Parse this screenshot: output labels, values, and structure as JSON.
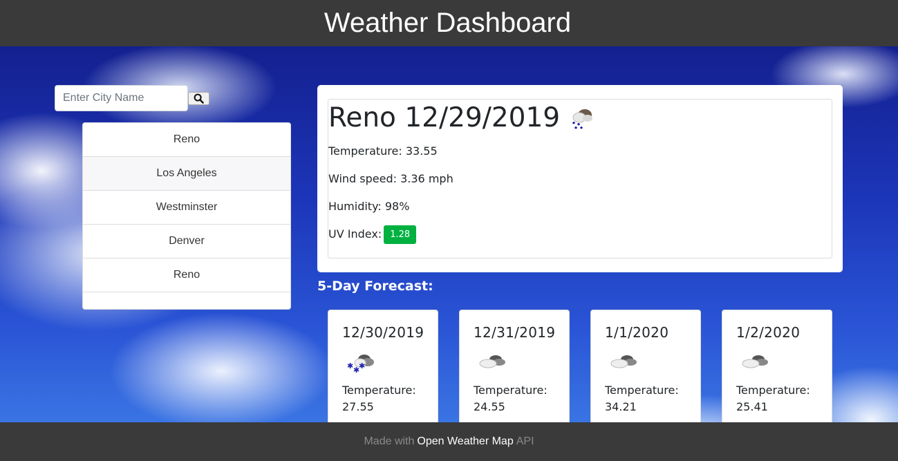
{
  "header": {
    "title": "Weather Dashboard"
  },
  "search": {
    "placeholder": "Enter City Name",
    "value": ""
  },
  "city_list": {
    "items": [
      {
        "label": "Reno"
      },
      {
        "label": "Los Angeles"
      },
      {
        "label": "Westminster"
      },
      {
        "label": "Denver"
      },
      {
        "label": "Reno"
      }
    ]
  },
  "current": {
    "title": "Reno 12/29/2019",
    "icon": "snow-rain-cloud-icon",
    "temperature": "Temperature: 33.55",
    "wind": "Wind speed: 3.36 mph",
    "humidity": "Humidity: 98%",
    "uv_label": "UV Index:",
    "uv_value": "1.28",
    "uv_color": "#00b140"
  },
  "forecast": {
    "heading": "5-Day Forecast:",
    "days": [
      {
        "date": "12/30/2019",
        "icon": "snow-cloud-icon",
        "temp_label": "Temperature:",
        "temp": "27.55"
      },
      {
        "date": "12/31/2019",
        "icon": "cloud-icon",
        "temp_label": "Temperature:",
        "temp": "24.55"
      },
      {
        "date": "1/1/2020",
        "icon": "cloud-icon",
        "temp_label": "Temperature:",
        "temp": "34.21"
      },
      {
        "date": "1/2/2020",
        "icon": "cloud-icon",
        "temp_label": "Temperature:",
        "temp": "25.41"
      }
    ]
  },
  "footer": {
    "prefix": "Made with",
    "link": "Open Weather Map",
    "suffix": "API"
  }
}
